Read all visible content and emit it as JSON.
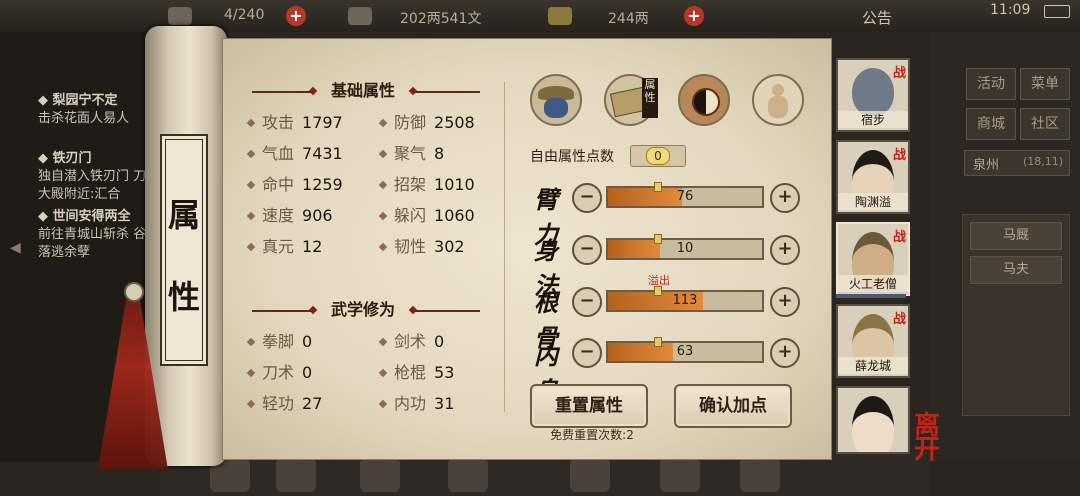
{
  "top_bar": {
    "bag_count": "4/240",
    "money": "202两541文",
    "gold": "244两",
    "notice": "公告",
    "time": "11:09"
  },
  "quests": [
    {
      "title": "◆ 梨园宁不定",
      "desc": "击杀花面人易人"
    },
    {
      "title": "◆ 铁刃门",
      "desc": "独自潜入铁刃门 刀大殿附近:汇合"
    },
    {
      "title": "◆ 世间安得两全",
      "desc": "前往青城山斩杀 谷落逃余孽"
    }
  ],
  "right_menu": {
    "buttons": [
      "活动",
      "菜单",
      "商城",
      "社区"
    ],
    "location": "泉州",
    "coords": "(18,11)",
    "list": [
      "马厩",
      "马夫"
    ]
  },
  "scroll_label": [
    "属",
    "性"
  ],
  "basic_section": {
    "title": "基础属性",
    "stats": [
      {
        "label": "攻击",
        "value": "1797"
      },
      {
        "label": "防御",
        "value": "2508"
      },
      {
        "label": "气血",
        "value": "7431"
      },
      {
        "label": "聚气",
        "value": "8"
      },
      {
        "label": "命中",
        "value": "1259"
      },
      {
        "label": "招架",
        "value": "1010"
      },
      {
        "label": "速度",
        "value": "906"
      },
      {
        "label": "躲闪",
        "value": "1060"
      },
      {
        "label": "真元",
        "value": "12"
      },
      {
        "label": "韧性",
        "value": "302"
      }
    ]
  },
  "martial_section": {
    "title": "武学修为",
    "stats": [
      {
        "label": "拳脚",
        "value": "0"
      },
      {
        "label": "剑术",
        "value": "0"
      },
      {
        "label": "刀术",
        "value": "0"
      },
      {
        "label": "枪棍",
        "value": "53"
      },
      {
        "label": "轻功",
        "value": "27"
      },
      {
        "label": "内功",
        "value": "31"
      }
    ]
  },
  "tabs": {
    "attr_tab_label": "属性"
  },
  "free_points": {
    "label": "自由属性点数",
    "value": "0"
  },
  "attributes": [
    {
      "name": "臂力",
      "value": "76",
      "fill": 0.48
    },
    {
      "name": "身法",
      "value": "10",
      "fill": 0.34
    },
    {
      "name": "根骨",
      "value": "113",
      "fill": 0.62
    },
    {
      "name": "内息",
      "value": "63",
      "fill": 0.42
    }
  ],
  "overflow_label": "溢出",
  "buttons": {
    "reset": "重置属性",
    "confirm": "确认加点",
    "reset_note": "免费重置次数:2"
  },
  "characters": [
    {
      "name": "宿步",
      "battle": "战"
    },
    {
      "name": "陶渊溢",
      "battle": "战"
    },
    {
      "name": "火工老僧",
      "battle": "战"
    },
    {
      "name": "薛龙城",
      "battle": "战"
    },
    {
      "name": "",
      "battle": ""
    }
  ],
  "leave": "离开",
  "colors": {
    "accent_red": "#c0241a",
    "bar_fill": "#e18a3a",
    "parchment": "#eae1cb"
  }
}
